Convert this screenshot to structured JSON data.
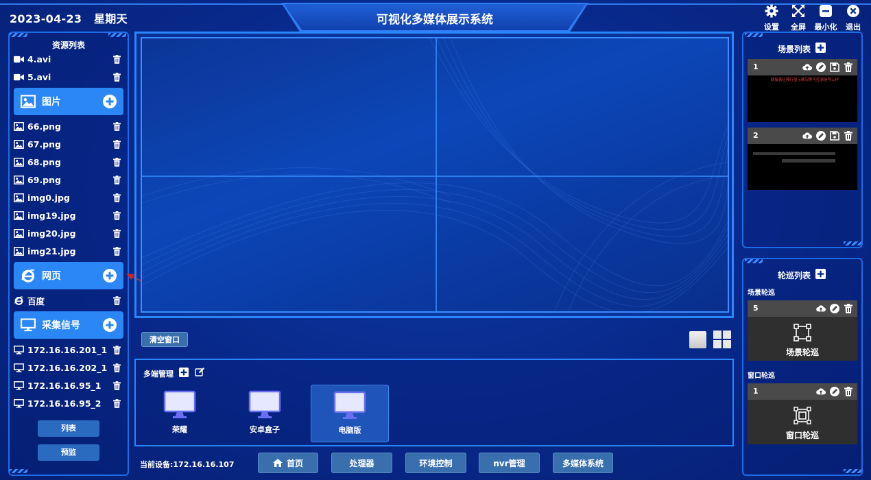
{
  "header": {
    "date": "2023-04-23",
    "weekday": "星期天",
    "title": "可视化多媒体展示系统",
    "buttons": [
      {
        "label": "设置",
        "icon": "gear-icon"
      },
      {
        "label": "全屏",
        "icon": "fullscreen-icon"
      },
      {
        "label": "最小化",
        "icon": "minimize-icon"
      },
      {
        "label": "退出",
        "icon": "close-icon"
      }
    ]
  },
  "resources": {
    "title": "资源列表",
    "videos": [
      "4.avi",
      "5.avi"
    ],
    "images": {
      "label": "图片",
      "items": [
        "66.png",
        "67.png",
        "68.png",
        "69.png",
        "img0.jpg",
        "img19.jpg",
        "img20.jpg",
        "img21.jpg"
      ]
    },
    "webpages": {
      "label": "网页",
      "items": [
        "百度"
      ]
    },
    "signals": {
      "label": "采集信号",
      "items": [
        "172.16.16.201_1",
        "172.16.16.202_1",
        "172.16.16.95_1",
        "172.16.16.95_2"
      ]
    },
    "list_button": "列表",
    "preview_button": "预监"
  },
  "stage": {
    "clear_button": "清空窗口"
  },
  "multi_end": {
    "title": "多端管理",
    "devices": [
      {
        "label": "荣耀",
        "active": false
      },
      {
        "label": "安卓盒子",
        "active": false
      },
      {
        "label": "电脑版",
        "active": true
      }
    ]
  },
  "footer": {
    "current_device": "当前设备:172.16.16.107",
    "nav": [
      "首页",
      "处理器",
      "环境控制",
      "nvr管理",
      "多媒体系统"
    ]
  },
  "scenes": {
    "title": "场景列表",
    "items": [
      {
        "id": "1",
        "preview_text": "联接表征预行显示情况等可控测信号上作"
      },
      {
        "id": "2",
        "preview_text": ""
      }
    ]
  },
  "tours": {
    "title": "轮巡列表",
    "scene_tour_label": "场景轮巡",
    "scene_tour": {
      "id": "5",
      "name": "场景轮巡"
    },
    "window_tour_label": "窗口轮巡",
    "window_tour": {
      "id": "1",
      "name": "窗口轮巡"
    }
  },
  "colors": {
    "background": "#08288a",
    "accent": "#2b87f5",
    "frame": "#2a86ff",
    "button": "#3a6fae"
  }
}
